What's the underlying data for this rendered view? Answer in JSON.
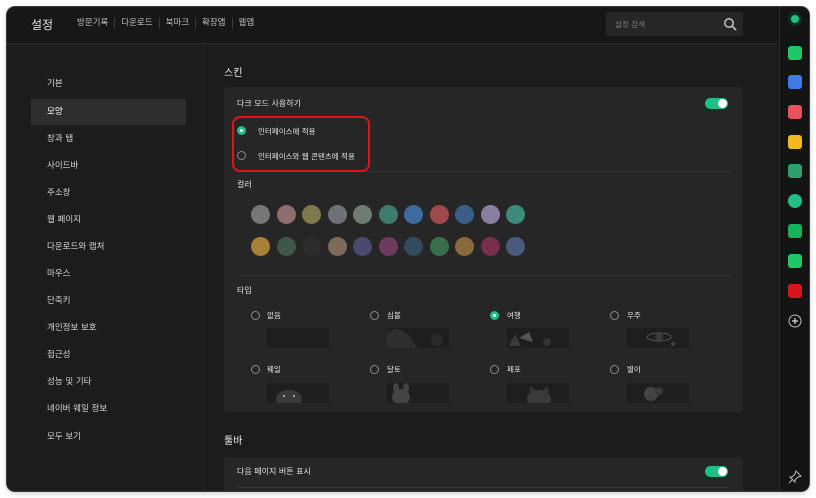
{
  "header": {
    "title": "설정",
    "tabs": [
      "방문기록",
      "다운로드",
      "북마크",
      "확장앱",
      "웹앱"
    ],
    "search_placeholder": "설정 검색"
  },
  "sidebar": {
    "items": [
      "기본",
      "모양",
      "창과 탭",
      "사이드바",
      "주소창",
      "웹 페이지",
      "다운로드와 캡처",
      "마우스",
      "단축키",
      "개인정보 보호",
      "접근성",
      "성능 및 기타",
      "네이버 웨일 정보",
      "모두 보기"
    ],
    "active_index": 1
  },
  "skin": {
    "title": "스킨",
    "dark_mode_label": "다크 모드 사용하기",
    "dark_mode_enabled": true,
    "radio_interface": "인터페이스에 적용",
    "radio_interface_web": "인터페이스와 웹 콘텐츠에 적용",
    "color_label": "컬러",
    "type_label": "타입",
    "types": [
      "없음",
      "심볼",
      "여행",
      "우주",
      "웨일",
      "달토",
      "페포",
      "별이"
    ],
    "selected_type_index": 2,
    "colors_row1": [
      "#777777",
      "#8c6e6e",
      "#7e7a4e",
      "#6c7278",
      "#6e7a74",
      "#3e7a6e",
      "#3f6aa0",
      "#9e4a4a",
      "#3a5e86",
      "#8a7ea0",
      "#3d8a7c"
    ],
    "colors_row2": [
      "#a88038",
      "#40554c",
      "#2c2c2c",
      "#7e6a58",
      "#4a4a6e",
      "#6e3a5e",
      "#344a5e",
      "#3a6e4a",
      "#8a6a3a",
      "#7a2e4e",
      "#4a5a7e"
    ]
  },
  "toolbar": {
    "title": "툴바",
    "next_page_label": "다음 페이지 버튼 표시",
    "next_page_enabled": true
  },
  "colors": {
    "accent": "#1fbf86",
    "highlight": "#e0141e"
  }
}
